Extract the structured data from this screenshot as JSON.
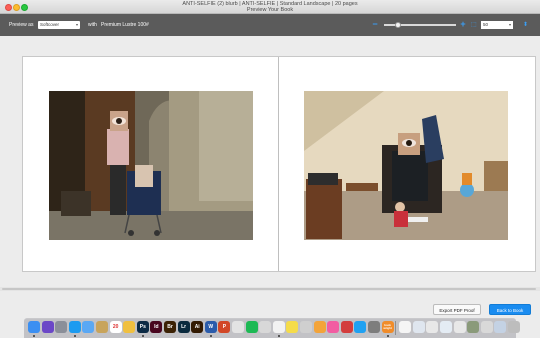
{
  "window": {
    "title": "ANTI-SELFIE (2) blurb | ANTI-SELFIE | Standard Landscape | 20 pages",
    "subtitle": "Preview Your Book"
  },
  "toolbar": {
    "preview_as_label": "Preview as",
    "preview_as_value": "Softcover",
    "with_label": "with",
    "paper_label": "Premium Lustre 100#",
    "zoom_minus": "−",
    "zoom_plus": "+",
    "zoom_value": "50",
    "zoom_fraction": 0.2
  },
  "buttons": {
    "export_pdf": "Export PDF Proof",
    "back_to_book": "Back to Book"
  },
  "dock": {
    "items": [
      {
        "name": "finder-icon",
        "label": "",
        "color": "#3b8ff2"
      },
      {
        "name": "siri-icon",
        "label": "",
        "color": "#6b47c7"
      },
      {
        "name": "launchpad-icon",
        "label": "",
        "color": "#8b8f99"
      },
      {
        "name": "safari-icon",
        "label": "",
        "color": "#1c9bf0"
      },
      {
        "name": "mail-icon",
        "label": "",
        "color": "#5aa8f4"
      },
      {
        "name": "notes-icon",
        "label": "",
        "color": "#c8a45c"
      },
      {
        "name": "calendar-icon",
        "label": "20",
        "color": "#ffffff"
      },
      {
        "name": "reminders-icon",
        "label": "",
        "color": "#f0c040"
      },
      {
        "name": "photoshop-icon",
        "label": "Ps",
        "color": "#0b2a45"
      },
      {
        "name": "indesign-icon",
        "label": "Id",
        "color": "#49061f"
      },
      {
        "name": "bridge-icon",
        "label": "Br",
        "color": "#3c2205"
      },
      {
        "name": "lightroom-icon",
        "label": "Lr",
        "color": "#0a2a3e"
      },
      {
        "name": "illustrator-icon",
        "label": "Ai",
        "color": "#331a02"
      },
      {
        "name": "word-icon",
        "label": "W",
        "color": "#2b5cab"
      },
      {
        "name": "powerpoint-icon",
        "label": "P",
        "color": "#d24726"
      },
      {
        "name": "acrobat-icon",
        "label": "",
        "color": "#e3e3e3"
      },
      {
        "name": "spotify-icon",
        "label": "",
        "color": "#1db954"
      },
      {
        "name": "messages-icon",
        "label": "",
        "color": "#d8d8d8"
      },
      {
        "name": "preview-icon",
        "label": "",
        "color": "#f2f2f2"
      },
      {
        "name": "stickies-icon",
        "label": "",
        "color": "#f5dc4a"
      },
      {
        "name": "folder-icon",
        "label": "",
        "color": "#cfcfcf"
      },
      {
        "name": "photos-icon",
        "label": "",
        "color": "#f3a43a"
      },
      {
        "name": "itunes-icon",
        "label": "",
        "color": "#f25da2"
      },
      {
        "name": "photo-booth-icon",
        "label": "",
        "color": "#d33d3d"
      },
      {
        "name": "app-store-icon",
        "label": "",
        "color": "#1fa1f2"
      },
      {
        "name": "system-preferences-icon",
        "label": "",
        "color": "#7d7d7d"
      },
      {
        "name": "blurb-bookwright-icon",
        "label": "book wright",
        "color": "#f08c2a"
      },
      {
        "name": "document-icon-1",
        "label": "",
        "color": "#f5f5f5"
      },
      {
        "name": "document-icon-2",
        "label": "",
        "color": "#dfe6ef"
      },
      {
        "name": "document-icon-3",
        "label": "",
        "color": "#e8e8e8"
      },
      {
        "name": "document-icon-4",
        "label": "",
        "color": "#e4ecf4"
      },
      {
        "name": "document-icon-5",
        "label": "",
        "color": "#e8e8e8"
      },
      {
        "name": "image-stack-icon",
        "label": "",
        "color": "#8a9a7a"
      },
      {
        "name": "grid-stack-icon",
        "label": "",
        "color": "#d9d9d9"
      },
      {
        "name": "downloads-icon",
        "label": "",
        "color": "#c4d2e4"
      },
      {
        "name": "trash-icon",
        "label": "",
        "color": "#bdbdbd"
      }
    ]
  }
}
